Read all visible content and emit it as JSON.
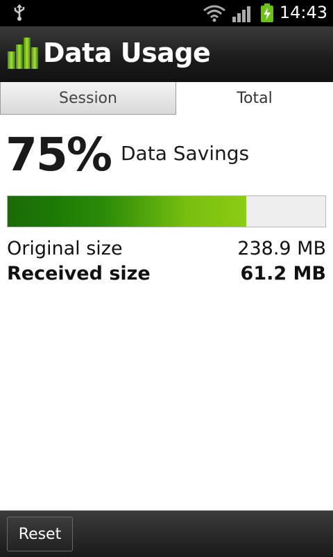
{
  "status_bar": {
    "time": "14:43",
    "icons": [
      "usb-icon",
      "wifi-icon",
      "signal-icon",
      "battery-charging-icon"
    ]
  },
  "title_bar": {
    "title": "Data Usage",
    "icon": "bar-chart-app-icon"
  },
  "tabs": [
    {
      "label": "Session",
      "selected": false
    },
    {
      "label": "Total",
      "selected": true
    }
  ],
  "summary": {
    "savings_percent": "75%",
    "savings_label": "Data Savings",
    "progress_fraction": 0.75
  },
  "sizes": {
    "original_label": "Original size",
    "original_value": "238.9 MB",
    "received_label": "Received size",
    "received_value": "61.2 MB"
  },
  "bottom_bar": {
    "reset_label": "Reset"
  },
  "colors": {
    "progress_start": "#1c6a05",
    "progress_end": "#8dcc14",
    "battery": "#6dc01a"
  }
}
